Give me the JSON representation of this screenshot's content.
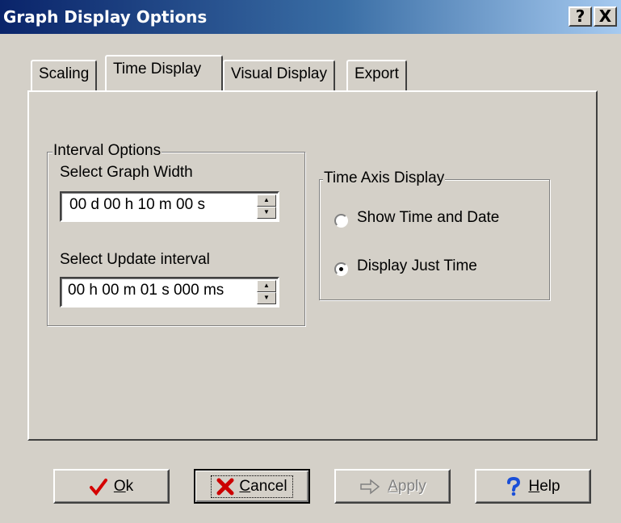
{
  "window": {
    "title": "Graph Display Options",
    "help_btn": "?",
    "close_btn": "X"
  },
  "tabs": [
    {
      "label": "Scaling",
      "active": false
    },
    {
      "label": "Time Display",
      "active": true
    },
    {
      "label": "Visual Display",
      "active": false
    },
    {
      "label": "Export",
      "active": false
    }
  ],
  "interval_options": {
    "group_label": "Interval Options",
    "graph_width_label": "Select Graph Width",
    "graph_width_value": "00 d 00 h 10 m 00 s",
    "update_interval_label": "Select Update interval",
    "update_interval_value": "00 h 00 m 01 s 000 ms"
  },
  "time_axis": {
    "group_label": "Time Axis Display",
    "option_time_date": "Show Time and Date",
    "option_just_time": "Display Just Time",
    "selected": "Display Just Time"
  },
  "buttons": {
    "ok": {
      "underline": "O",
      "rest": "k"
    },
    "cancel": {
      "underline": "C",
      "rest": "ancel"
    },
    "apply": {
      "underline": "A",
      "rest": "pply"
    },
    "help": {
      "underline": "H",
      "rest": "elp"
    }
  },
  "colors": {
    "titlebar_start": "#0a246a",
    "titlebar_end": "#a6caf0",
    "face": "#d4d0c8",
    "ok_check": "#d40000",
    "cancel_x": "#cc0000",
    "help_q": "#1a4fd8"
  },
  "icons": {
    "ok": "checkmark-icon",
    "cancel": "x-icon",
    "apply": "apply-arrow-icon",
    "help": "question-mark-icon"
  }
}
